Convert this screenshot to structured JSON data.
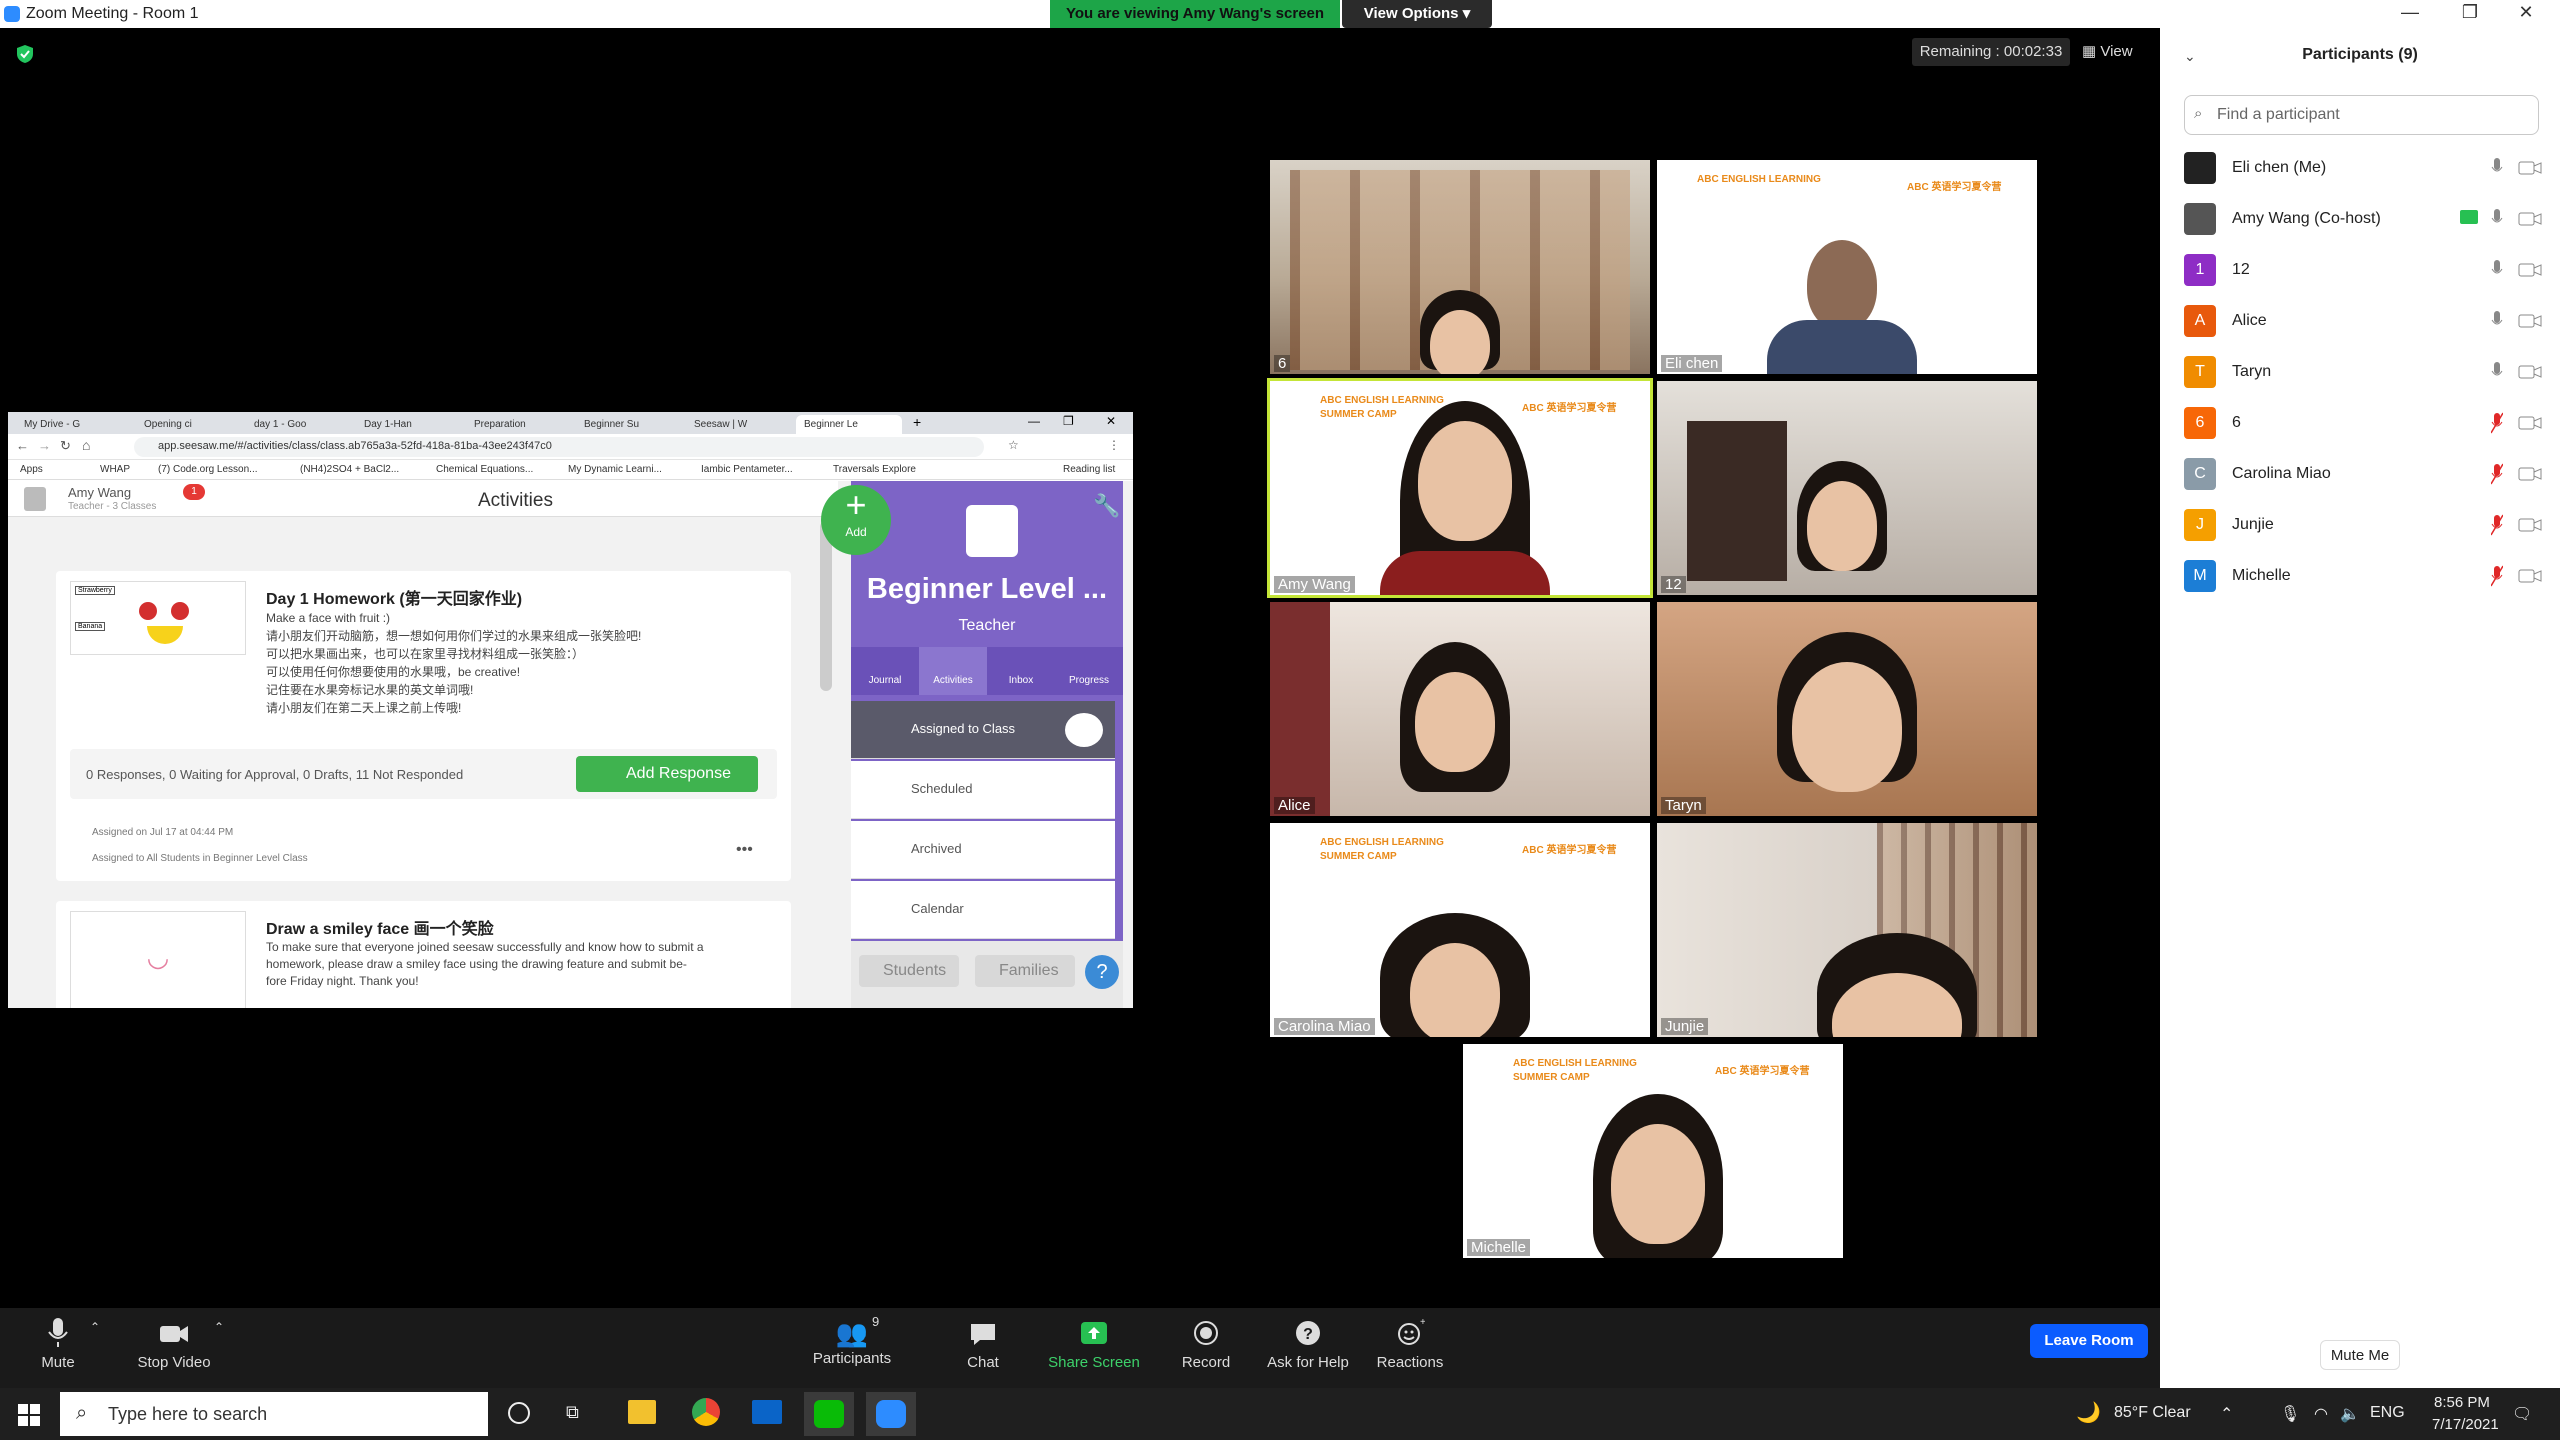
{
  "window": {
    "title": "Zoom Meeting - Room 1",
    "viewing_banner": "You are viewing Amy Wang's screen",
    "view_options": "View Options",
    "remaining": "Remaining : 00:02:33",
    "view": "View"
  },
  "browser": {
    "tabs": [
      "My Drive - G",
      "Opening ci",
      "day 1 - Goo",
      "Day 1-Han",
      "Preparation",
      "Beginner Su",
      "Seesaw | W",
      "Beginner Le"
    ],
    "url": "app.seesaw.me/#/activities/class/class.ab765a3a-52fd-418a-81ba-43ee243f47c0",
    "bookmarks": [
      "Apps",
      "WHAP",
      "(7) Code.org Lesson...",
      "(NH4)2SO4 + BaCl2...",
      "Chemical Equations...",
      "My Dynamic Learni...",
      "Iambic Pentameter...",
      "Traversals Explore",
      "Reading list"
    ]
  },
  "seesaw": {
    "user_name": "Amy Wang",
    "user_sub": "Teacher - 3 Classes",
    "notif": "1",
    "header": "Activities",
    "add": "Add",
    "class_name": "Beginner Level ...",
    "role": "Teacher",
    "nav": [
      "Journal",
      "Activities",
      "Inbox",
      "Progress"
    ],
    "menu": [
      "Assigned to Class",
      "Scheduled",
      "Archived",
      "Calendar"
    ],
    "students": "Students",
    "families": "Families",
    "card1": {
      "title": "Day 1 Homework (第一天回家作业)",
      "lines": [
        "Make a face with fruit :)",
        "请小朋友们开动脑筋，想一想如何用你们学过的水果来组成一张笑脸吧!",
        "可以把水果画出来，也可以在家里寻找材料组成一张笑脸：）",
        "可以使用任何你想要使用的水果哦，be creative!",
        "记住要在水果旁标记水果的英文单词哦!",
        "请小朋友们在第二天上课之前上传哦!"
      ],
      "stats": "0 Responses, 0 Waiting for Approval, 0 Drafts, 11 Not Responded",
      "add_response": "Add Response",
      "assigned_on": "Assigned on Jul 17 at 04:44 PM",
      "assigned_to": "Assigned to All Students in Beginner Level Class",
      "img_labels": [
        "Strawberry",
        "Banana"
      ]
    },
    "card2": {
      "title": "Draw a smiley face 画一个笑脸",
      "lines": [
        "To make sure that everyone joined seesaw successfully and know how to submit a",
        "homework, please draw a smiley face using the drawing feature and submit be-",
        "fore Friday night. Thank you!"
      ]
    }
  },
  "videos": [
    {
      "name": "6",
      "type": "room"
    },
    {
      "name": "Eli chen",
      "type": "camp"
    },
    {
      "name": "Amy Wang",
      "type": "camp"
    },
    {
      "name": "12",
      "type": "room"
    },
    {
      "name": "Alice",
      "type": "room"
    },
    {
      "name": "Taryn",
      "type": "room"
    },
    {
      "name": "Carolina Miao",
      "type": "camp"
    },
    {
      "name": "Junjie",
      "type": "room"
    },
    {
      "name": "Michelle",
      "type": "camp"
    }
  ],
  "camp": {
    "en": "ABC ENGLISH LEARNING",
    "en2": "SUMMER CAMP",
    "cn": "ABC 英语学习夏令营"
  },
  "participants": {
    "header": "Participants (9)",
    "search_placeholder": "Find a participant",
    "list": [
      {
        "name": "Eli chen (Me)",
        "initial": "",
        "color": "#222222",
        "muted": false
      },
      {
        "name": "Amy Wang (Co-host)",
        "initial": "",
        "color": "#555555",
        "muted": false
      },
      {
        "name": "12",
        "initial": "1",
        "color": "#8e2dc5",
        "muted": false
      },
      {
        "name": "Alice",
        "initial": "A",
        "color": "#e8590c",
        "muted": false
      },
      {
        "name": "Taryn",
        "initial": "T",
        "color": "#f08c00",
        "muted": false
      },
      {
        "name": "6",
        "initial": "6",
        "color": "#f76707",
        "muted": true
      },
      {
        "name": "Carolina Miao",
        "initial": "C",
        "color": "#8a9ba8",
        "muted": true
      },
      {
        "name": "Junjie",
        "initial": "J",
        "color": "#f59f00",
        "muted": true
      },
      {
        "name": "Michelle",
        "initial": "M",
        "color": "#1c7ed6",
        "muted": true
      }
    ],
    "mute_me": "Mute Me"
  },
  "toolbar": {
    "mute": "Mute",
    "stop_video": "Stop Video",
    "participants": "Participants",
    "participants_count": "9",
    "chat": "Chat",
    "share_screen": "Share Screen",
    "record": "Record",
    "ask_help": "Ask for Help",
    "reactions": "Reactions",
    "leave": "Leave Room"
  },
  "taskbar": {
    "search_placeholder": "Type here to search",
    "weather": "85°F  Clear",
    "lang": "ENG",
    "time": "8:56 PM",
    "date": "7/17/2021"
  }
}
